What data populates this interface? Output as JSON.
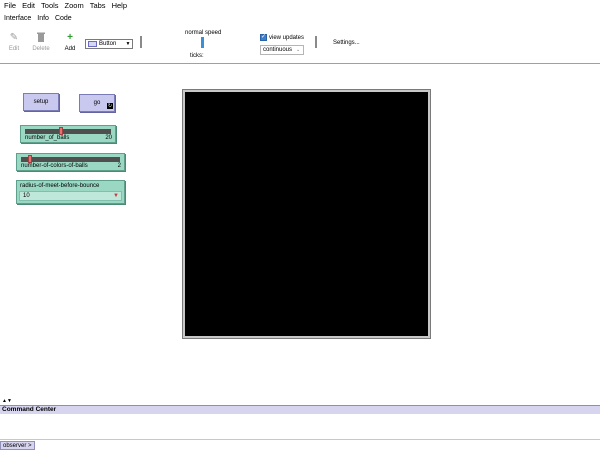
{
  "menubar": {
    "items": [
      "File",
      "Edit",
      "Tools",
      "Zoom",
      "Tabs",
      "Help"
    ]
  },
  "tabs": [
    "Interface",
    "Info",
    "Code"
  ],
  "toolbar": {
    "edit_label": "Edit",
    "delete_label": "Delete",
    "add_label": "Add",
    "widget_type": "Button",
    "speed_label": "normal speed",
    "ticks_label": "ticks:",
    "view_updates_label": "view updates",
    "view_updates_checked": true,
    "update_mode": "continuous",
    "settings_label": "Settings..."
  },
  "widgets": {
    "setup_button": {
      "label": "setup"
    },
    "go_button": {
      "label": "go",
      "forever": true
    },
    "slider_balls": {
      "name": "number_of_balls",
      "value": "20"
    },
    "slider_colors": {
      "name": "number-of-colors-of-balls",
      "value": "2"
    },
    "chooser_radius": {
      "name": "radius-of-meet-before-bounce",
      "value": "10"
    }
  },
  "world": {
    "background": "#000000"
  },
  "command_center": {
    "title": "Command Center",
    "prompt": "observer >",
    "input_value": ""
  },
  "colors": {
    "button": "#c9c9ef",
    "slider": "#9ad8c4",
    "accent": "#3a8fd9"
  }
}
